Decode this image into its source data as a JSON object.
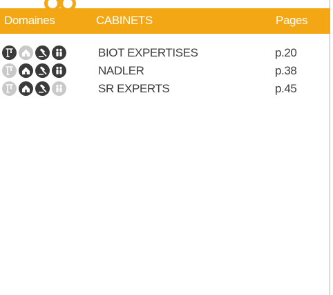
{
  "header": {
    "domains_label": "Domaines",
    "cabinets_label": "CABINETS",
    "pages_label": "Pages"
  },
  "colors": {
    "accent": "#f3a714",
    "icon_active": "#3a3a3a",
    "icon_inactive": "#c9c9c9",
    "text": "#3c3c3c"
  },
  "domain_icons": [
    "crane-icon",
    "house-icon",
    "gavel-icon",
    "family-icon"
  ],
  "cabinets": [
    {
      "name": "BIOT EXPERTISES",
      "page": "p.20",
      "domains_active": [
        true,
        false,
        true,
        true
      ]
    },
    {
      "name": "NADLER",
      "page": "p.38",
      "domains_active": [
        false,
        true,
        true,
        true
      ]
    },
    {
      "name": "SR EXPERTS",
      "page": "p.45",
      "domains_active": [
        false,
        true,
        true,
        false
      ]
    }
  ]
}
